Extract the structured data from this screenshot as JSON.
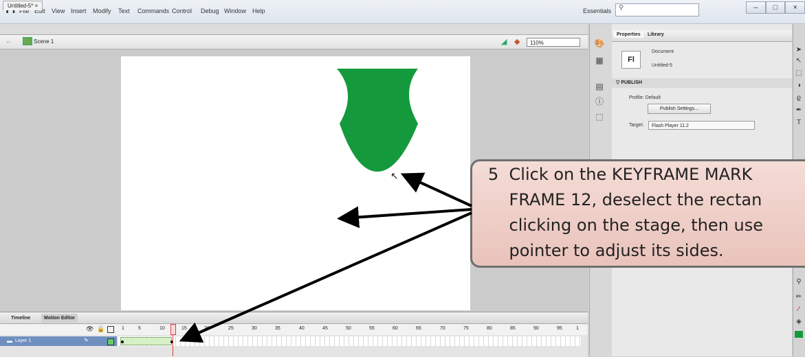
{
  "app": {
    "logo": "Fl"
  },
  "menu": [
    "File",
    "Edit",
    "View",
    "Insert",
    "Modify",
    "Text",
    "Commands",
    "Control",
    "Debug",
    "Window",
    "Help"
  ],
  "workspace": "Essentials",
  "window_buttons": [
    "–",
    "□",
    "×"
  ],
  "document_tab": "Untitled-5* ×",
  "scene": "Scene 1",
  "zoom": "110%",
  "timeline": {
    "tabs": [
      "Timeline",
      "Motion Editor"
    ],
    "frame_numbers": [
      "1",
      "5",
      "10",
      "15",
      "20",
      "25",
      "30",
      "35",
      "40",
      "45",
      "50",
      "55",
      "60",
      "65",
      "70",
      "75",
      "80",
      "85",
      "90",
      "95",
      "1"
    ],
    "layer_name": "Layer 1"
  },
  "properties": {
    "tabs": [
      "Properties",
      "Library"
    ],
    "doc_type": "Document",
    "doc_name": "Untitled-5",
    "section": "PUBLISH",
    "profile": "Profile: Default",
    "publish_settings": "Publish Settings...",
    "target_label": "Target:",
    "target_value": "Flash Player 11.2"
  },
  "callout": {
    "text": "5  Click on the KEYFRAME MARK\n    FRAME 12, deselect the rectan\n    clicking on the stage, then use\n    pointer to adjust its sides."
  },
  "colors": {
    "shape": "#149a3c",
    "callout_bg": "#efd2cb",
    "arrow": "#000000"
  }
}
